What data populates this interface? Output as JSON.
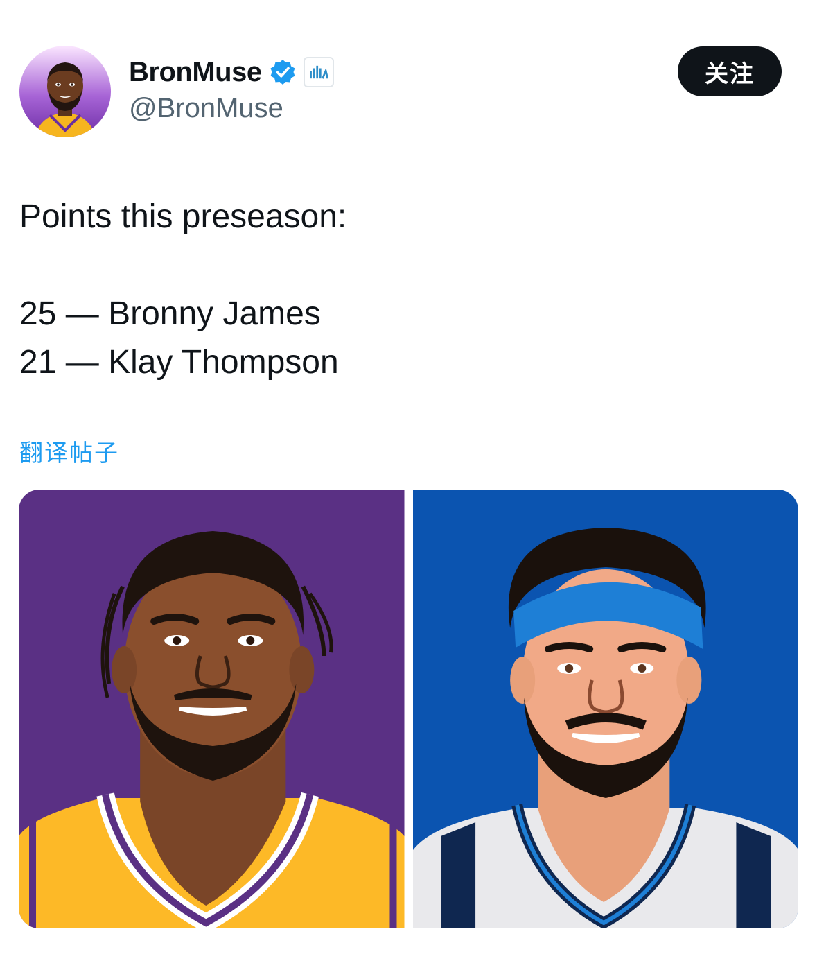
{
  "author": {
    "display_name": "BronMuse",
    "handle": "@BronMuse",
    "avatar_icon": "lebron-avatar-icon",
    "verified_icon": "verified-badge-icon",
    "affiliate_icon": "affiliate-badge-icon"
  },
  "follow_button": {
    "label": "关注"
  },
  "tweet": {
    "lines": [
      "Points this preseason:",
      "",
      "25 — Bronny James",
      "21 — Klay Thompson"
    ]
  },
  "translate_link": {
    "label": "翻译帖子"
  },
  "media": [
    {
      "icon": "bronny-james-illustration",
      "background": "#5a3084"
    },
    {
      "icon": "klay-thompson-illustration",
      "background": "#0b54b0"
    }
  ],
  "colors": {
    "accent": "#1d9bf0",
    "text": "#0f1419",
    "secondary": "#536471",
    "lakers_purple": "#5a3084",
    "lakers_gold": "#fdb927",
    "mavs_blue": "#0b54b0"
  }
}
